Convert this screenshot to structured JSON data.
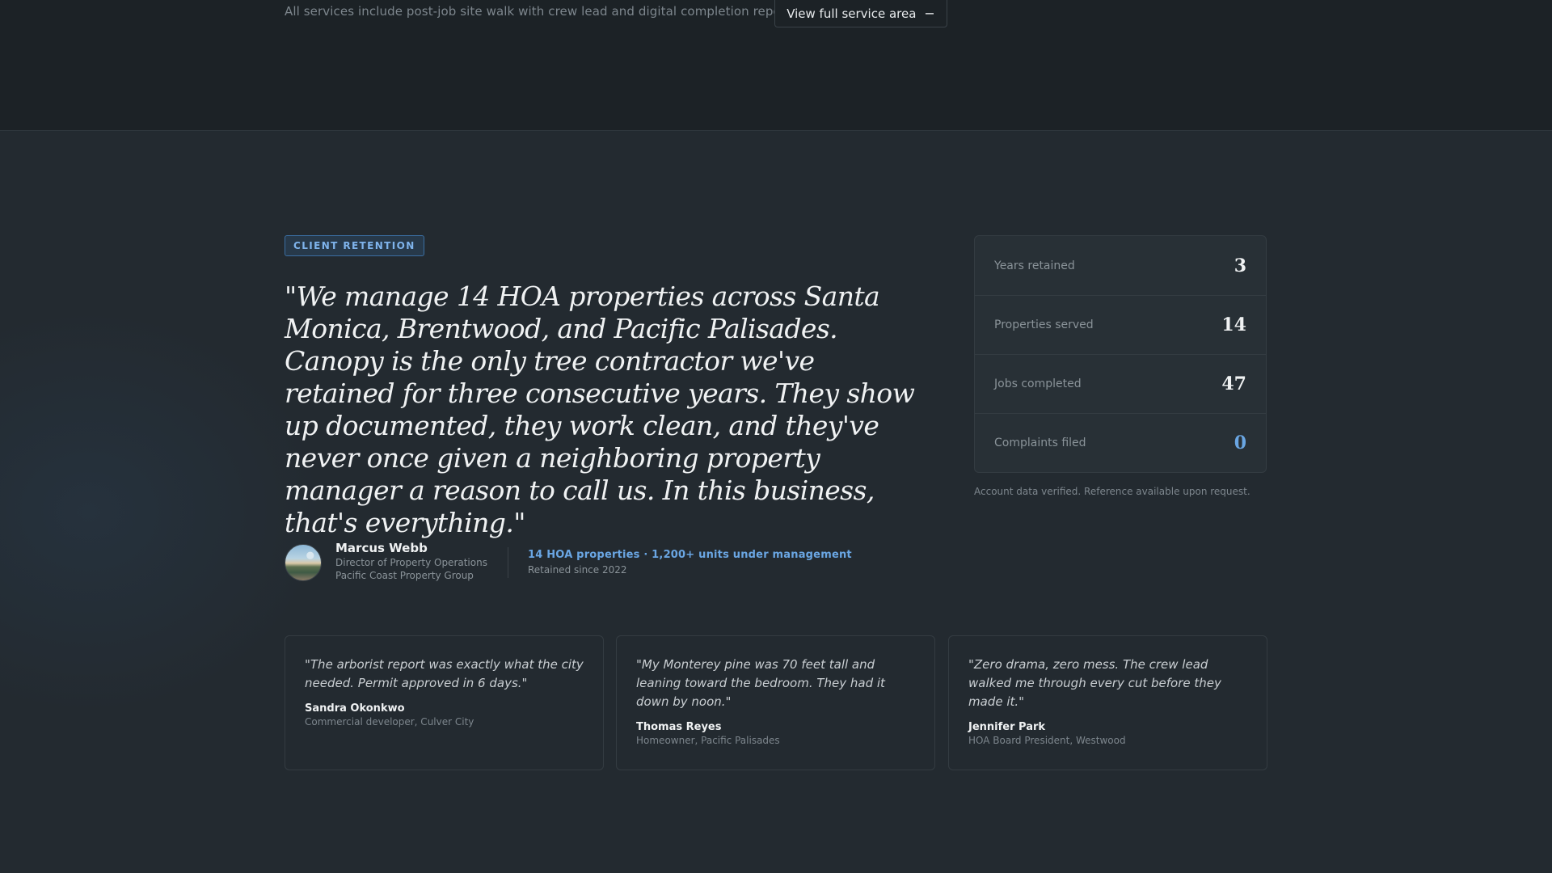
{
  "top": {
    "note": "All services include post-job site walk with crew lead and digital completion report.",
    "service_button": "View full service area",
    "service_button_icon": "minus-icon"
  },
  "badge": "CLIENT RETENTION",
  "quote": "\"We manage 14 HOA properties across Santa Monica, Brentwood, and Pacific Palisades. Canopy is the only tree contractor we've retained for three consecutive years. They show up documented, they work clean, and they've never once given a neighboring property manager a reason to call us. In this business, that's everything.\"",
  "author": {
    "name": "Marcus Webb",
    "title": "Director of Property Operations",
    "company": "Pacific Coast Property Group",
    "highlight": "14 HOA properties · 1,200+ units under management",
    "retained": "Retained since 2022"
  },
  "stats": [
    {
      "label": "Years retained",
      "value": "3"
    },
    {
      "label": "Properties served",
      "value": "14"
    },
    {
      "label": "Jobs completed",
      "value": "47"
    },
    {
      "label": "Complaints filed",
      "value": "0"
    }
  ],
  "stats_note": "Account data verified. Reference available upon request.",
  "testimonials": [
    {
      "quote": "\"The arborist report was exactly what the city needed. Permit approved in 6 days.\"",
      "name": "Sandra Okonkwo",
      "role": "Commercial developer, Culver City"
    },
    {
      "quote": "\"My Monterey pine was 70 feet tall and leaning toward the bedroom. They had it down by noon.\"",
      "name": "Thomas Reyes",
      "role": "Homeowner, Pacific Palisades"
    },
    {
      "quote": "\"Zero drama, zero mess. The crew lead walked me through every cut before they made it.\"",
      "name": "Jennifer Park",
      "role": "HOA Board President, Westwood"
    }
  ],
  "colors": {
    "accent": "#6aa6e3",
    "background": "#232a30",
    "top_band": "#1c2226"
  }
}
